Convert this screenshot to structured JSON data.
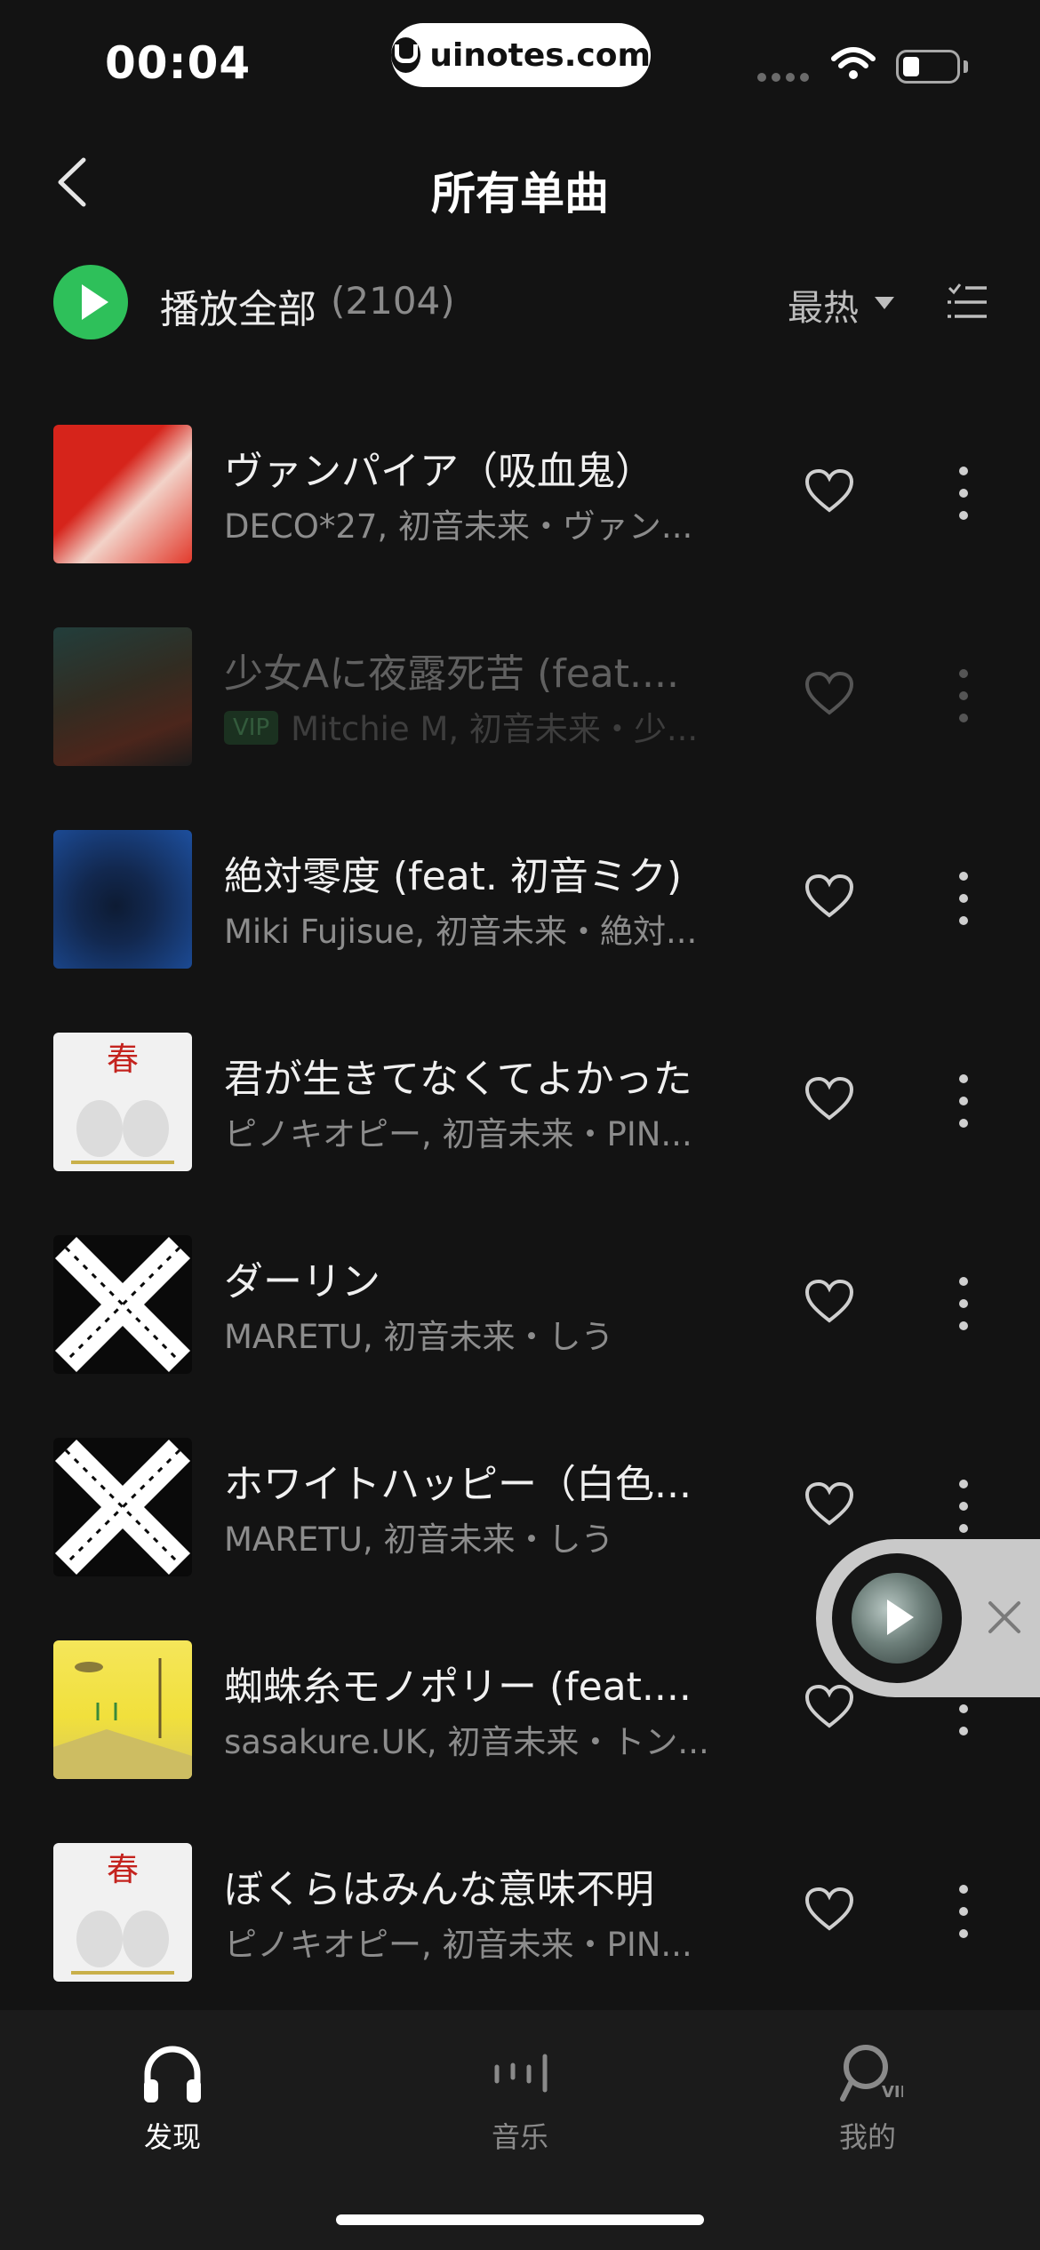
{
  "status_bar": {
    "time": "00:04",
    "url": "uinotes.com"
  },
  "header": {
    "title": "所有单曲"
  },
  "play_all": {
    "label": "播放全部",
    "count": "(2104)",
    "sort_label": "最热"
  },
  "songs": [
    {
      "title": "ヴァンパイア（吸血鬼）",
      "subtitle": "DECO*27, 初音未来・ヴァン...",
      "vip": "",
      "cover_colors": [
        "#d6241b",
        "#f2d2c8"
      ],
      "available": true
    },
    {
      "title": "少女Aに夜露死苦 (feat....",
      "subtitle": "Mitchie M, 初音未来・少...",
      "vip": "VIP",
      "cover_colors": [
        "#3e8d86",
        "#b4482b"
      ],
      "available": false
    },
    {
      "title": "絶対零度 (feat. 初音ミク)",
      "subtitle": "Miki Fujisue, 初音未来・絶対...",
      "vip": "",
      "cover_colors": [
        "#1d4f9e",
        "#0d1b33"
      ],
      "available": true
    },
    {
      "title": "君が生きてなくてよかった",
      "subtitle": "ピノキオピー, 初音未来・PIN...",
      "vip": "",
      "cover_colors": [
        "#f1f1f1",
        "#c4231e"
      ],
      "available": true
    },
    {
      "title": "ダーリン",
      "subtitle": "MARETU, 初音未来・しう",
      "vip": "",
      "cover_colors": [
        "#0a0a0a",
        "#ffffff"
      ],
      "available": true
    },
    {
      "title": "ホワイトハッピー（白色...",
      "subtitle": "MARETU, 初音未来・しう",
      "vip": "",
      "cover_colors": [
        "#0a0a0a",
        "#ffffff"
      ],
      "available": true
    },
    {
      "title": "蜘蛛糸モノポリー (feat....",
      "subtitle": "sasakure.UK, 初音未来・トン...",
      "vip": "",
      "cover_colors": [
        "#f1e03c",
        "#8a7b3a"
      ],
      "available": true
    },
    {
      "title": "ぼくらはみんな意味不明",
      "subtitle": "ピノキオピー, 初音未来・PIN...",
      "vip": "",
      "cover_colors": [
        "#f1f1f1",
        "#c4231e"
      ],
      "available": true
    }
  ],
  "tabs": [
    {
      "label": "发现",
      "icon": "headphones-icon",
      "active": true
    },
    {
      "label": "音乐",
      "icon": "music-bars-icon",
      "active": false
    },
    {
      "label": "我的",
      "icon": "vip-user-icon",
      "active": false
    }
  ],
  "colors": {
    "accent": "#2ec05a",
    "background": "#131313"
  }
}
